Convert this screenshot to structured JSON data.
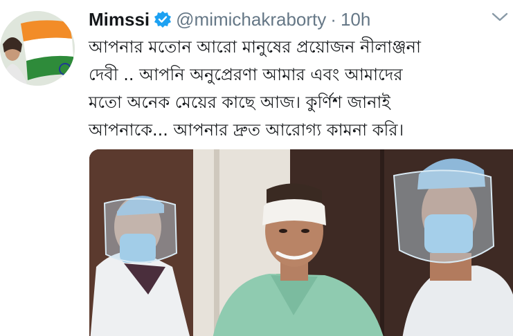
{
  "author": {
    "display_name": "Mimssi",
    "handle": "@mimichakraborty",
    "separator": "·",
    "timestamp": "10h",
    "verified": true
  },
  "tweet": {
    "text_lines": [
      "আপনার মতোন আরো মানুষের প্রয়োজন নীলাঞ্জনা",
      "দেবী .. আপনি অনুপ্রেরণা আমার এবং আমাদের",
      "মতো অনেক মেয়ের কাছে আজ। কুর্ণিশ জানাই",
      "আপনাকে... আপনার দ্রুত আরোগ্য কামনা করি।"
    ]
  },
  "icons": {
    "verified": "verified-badge-icon",
    "menu": "chevron-down-icon"
  },
  "colors": {
    "text_primary": "#14171a",
    "text_secondary": "#657786",
    "verified_blue": "#1da1f2"
  }
}
